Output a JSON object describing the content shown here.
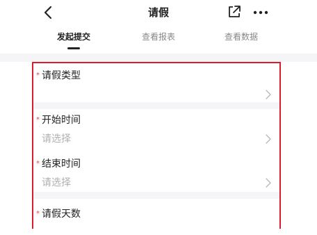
{
  "header": {
    "title": "请假"
  },
  "tabs": [
    {
      "label": "发起提交",
      "active": true
    },
    {
      "label": "查看报表",
      "active": false
    },
    {
      "label": "查看数据",
      "active": false
    }
  ],
  "form": {
    "fields": [
      {
        "required_mark": "*",
        "label": "请假类型",
        "value": ""
      },
      {
        "required_mark": "*",
        "label": "开始时间",
        "value": "请选择"
      },
      {
        "required_mark": "*",
        "label": "结束时间",
        "value": "请选择"
      },
      {
        "required_mark": "*",
        "label": "请假天数",
        "value": ""
      }
    ]
  },
  "colors": {
    "highlight_border": "#d81e2c",
    "required_mark": "#e64340",
    "placeholder_text": "#b0b0b0",
    "section_gap": "#f5f5f7"
  },
  "icons": {
    "back": "back-icon",
    "share": "share-icon",
    "more": "more-icon",
    "field_arrow": "chevron-right-icon"
  }
}
